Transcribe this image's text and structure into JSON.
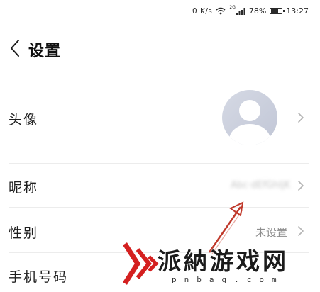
{
  "status_bar": {
    "network_speed": "0 K/s",
    "network_type": "2G",
    "battery": "78%",
    "battery_level": 0.78,
    "time": "13:27"
  },
  "header": {
    "title": "设置"
  },
  "rows": {
    "avatar": {
      "label": "头像"
    },
    "nickname": {
      "label": "昵称",
      "value": "Abc·dEfGhIjK"
    },
    "gender": {
      "label": "性别",
      "value": "未设置"
    },
    "phone": {
      "label": "手机号码"
    }
  },
  "watermark": {
    "text": "派納游戏网",
    "sub": "pnbag.com"
  },
  "colors": {
    "annotation_arrow": "#c0392b",
    "watermark_red": "#d42020"
  }
}
